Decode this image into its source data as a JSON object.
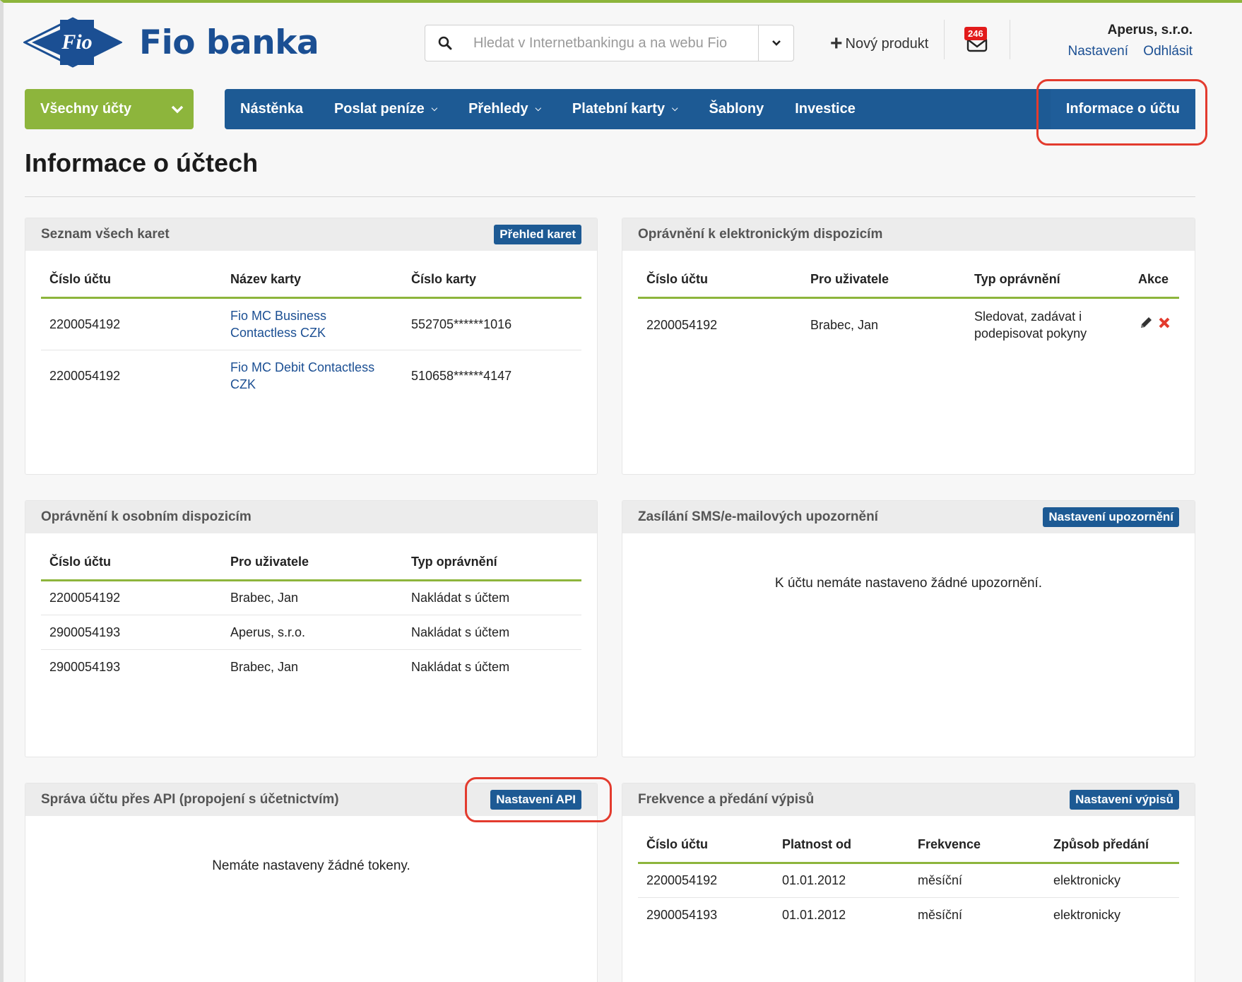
{
  "header": {
    "brand": "Fio banka",
    "logo_text": "Fio",
    "search_placeholder": "Hledat v Internetbankingu a na webu Fio",
    "new_product": "Nový produkt",
    "mail_count": "246",
    "user_name": "Aperus, s.r.o.",
    "settings_link": "Nastavení",
    "logout_link": "Odhlásit"
  },
  "nav": {
    "accounts": "Všechny účty",
    "items": [
      "Nástěnka",
      "Poslat peníze",
      "Přehledy",
      "Platební karty",
      "Šablony",
      "Investice"
    ],
    "active": "Informace o účtu"
  },
  "page": {
    "title": "Informace o účtech"
  },
  "cards": {
    "title": "Seznam všech karet",
    "button": "Přehled karet",
    "headers": [
      "Číslo účtu",
      "Název karty",
      "Číslo karty"
    ],
    "rows": [
      [
        "2200054192",
        "Fio MC Business Contactless CZK",
        "552705******1016"
      ],
      [
        "2200054192",
        "Fio MC Debit Contactless CZK",
        "510658******4147"
      ]
    ]
  },
  "electronic": {
    "title": "Oprávnění k elektronickým dispozicím",
    "headers": [
      "Číslo účtu",
      "Pro uživatele",
      "Typ oprávnění",
      "Akce"
    ],
    "rows": [
      [
        "2200054192",
        "Brabec, Jan",
        "Sledovat, zadávat i podepisovat pokyny"
      ]
    ]
  },
  "personal": {
    "title": "Oprávnění k osobním dispozicím",
    "headers": [
      "Číslo účtu",
      "Pro uživatele",
      "Typ oprávnění"
    ],
    "rows": [
      [
        "2200054192",
        "Brabec, Jan",
        "Nakládat s účtem"
      ],
      [
        "2900054193",
        "Aperus, s.r.o.",
        "Nakládat s účtem"
      ],
      [
        "2900054193",
        "Brabec, Jan",
        "Nakládat s účtem"
      ]
    ]
  },
  "notifications": {
    "title": "Zasílání SMS/e-mailových upozornění",
    "button": "Nastavení upozornění",
    "empty": "K účtu nemáte nastaveno žádné upozornění."
  },
  "api": {
    "title": "Správa účtu přes API (propojení s účetnictvím)",
    "button": "Nastavení API",
    "empty": "Nemáte nastaveny žádné tokeny."
  },
  "statements": {
    "title": "Frekvence a předání výpisů",
    "button": "Nastavení výpisů",
    "headers": [
      "Číslo účtu",
      "Platnost od",
      "Frekvence",
      "Způsob předání"
    ],
    "rows": [
      [
        "2200054192",
        "01.01.2012",
        "měsíční",
        "elektronicky"
      ],
      [
        "2900054193",
        "01.01.2012",
        "měsíční",
        "elektronicky"
      ]
    ]
  },
  "colors": {
    "brand_blue": "#1d5a94",
    "accent_green": "#8db53c",
    "highlight_red": "#e33b2e",
    "badge_red": "#e21b1b"
  }
}
